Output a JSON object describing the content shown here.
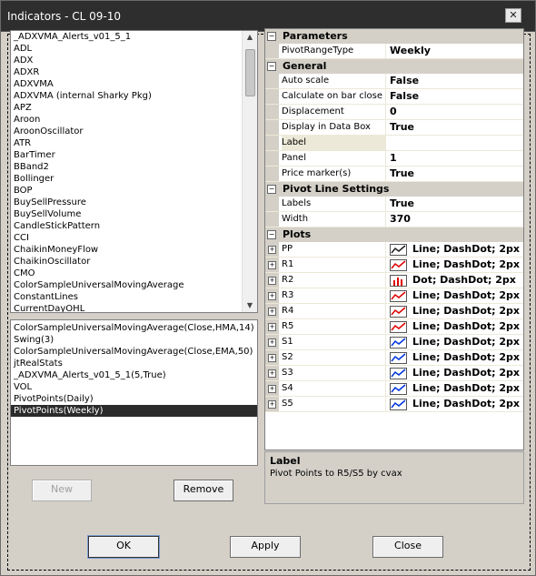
{
  "window": {
    "title": "Indicators - CL 09-10",
    "close_glyph": "✕"
  },
  "available_list": {
    "items": [
      "_ADXVMA_Alerts_v01_5_1",
      "ADL",
      "ADX",
      "ADXR",
      "ADXVMA",
      "ADXVMA (internal Sharky Pkg)",
      "APZ",
      "Aroon",
      "AroonOscillator",
      "ATR",
      "BarTimer",
      "BBand2",
      "Bollinger",
      "BOP",
      "BuySellPressure",
      "BuySellVolume",
      "CandleStickPattern",
      "CCI",
      "ChaikinMoneyFlow",
      "ChaikinOscillator",
      "CMO",
      "ColorSampleUniversalMovingAverage",
      "ConstantLines",
      "CurrentDayOHL"
    ]
  },
  "applied_list": {
    "items": [
      "ColorSampleUniversalMovingAverage(Close,HMA,14)",
      "Swing(3)",
      "ColorSampleUniversalMovingAverage(Close,EMA,50)",
      "jtRealStats",
      "_ADXVMA_Alerts_v01_5_1(5,True)",
      "VOL",
      "PivotPoints(Daily)",
      "PivotPoints(Weekly)"
    ],
    "selected": "PivotPoints(Weekly)"
  },
  "buttons": {
    "new": "New",
    "remove": "Remove",
    "ok": "OK",
    "apply": "Apply",
    "close": "Close"
  },
  "properties": {
    "parameters": {
      "title": "Parameters",
      "rows": [
        {
          "name": "PivotRangeType",
          "value": "Weekly"
        }
      ]
    },
    "general": {
      "title": "General",
      "rows": [
        {
          "name": "Auto scale",
          "value": "False"
        },
        {
          "name": "Calculate on bar close",
          "value": "False"
        },
        {
          "name": "Displacement",
          "value": "0"
        },
        {
          "name": "Display in Data Box",
          "value": "True"
        },
        {
          "name": "Label",
          "value": ""
        },
        {
          "name": "Panel",
          "value": "1"
        },
        {
          "name": "Price marker(s)",
          "value": "True"
        }
      ]
    },
    "pivot_line_settings": {
      "title": "Pivot Line Settings",
      "rows": [
        {
          "name": "Labels",
          "value": "True"
        },
        {
          "name": "Width",
          "value": "370"
        }
      ]
    },
    "plots": {
      "title": "Plots",
      "rows": [
        {
          "name": "PP",
          "value": "Line; DashDot; 2px",
          "color": "#222222",
          "kind": "line"
        },
        {
          "name": "R1",
          "value": "Line; DashDot; 2px",
          "color": "#e00000",
          "kind": "line"
        },
        {
          "name": "R2",
          "value": "Dot; DashDot; 2px",
          "color": "#e00000",
          "kind": "bars"
        },
        {
          "name": "R3",
          "value": "Line; DashDot; 2px",
          "color": "#e00000",
          "kind": "line"
        },
        {
          "name": "R4",
          "value": "Line; DashDot; 2px",
          "color": "#e00000",
          "kind": "line"
        },
        {
          "name": "R5",
          "value": "Line; DashDot; 2px",
          "color": "#e00000",
          "kind": "line"
        },
        {
          "name": "S1",
          "value": "Line; DashDot; 2px",
          "color": "#0033dd",
          "kind": "line"
        },
        {
          "name": "S2",
          "value": "Line; DashDot; 2px",
          "color": "#0033dd",
          "kind": "line"
        },
        {
          "name": "S3",
          "value": "Line; DashDot; 2px",
          "color": "#0033dd",
          "kind": "line"
        },
        {
          "name": "S4",
          "value": "Line; DashDot; 2px",
          "color": "#0033dd",
          "kind": "line"
        },
        {
          "name": "S5",
          "value": "Line; DashDot; 2px",
          "color": "#0033dd",
          "kind": "line"
        }
      ]
    }
  },
  "description": {
    "title": "Label",
    "text": "Pivot Points to R5/S5 by cvax"
  }
}
